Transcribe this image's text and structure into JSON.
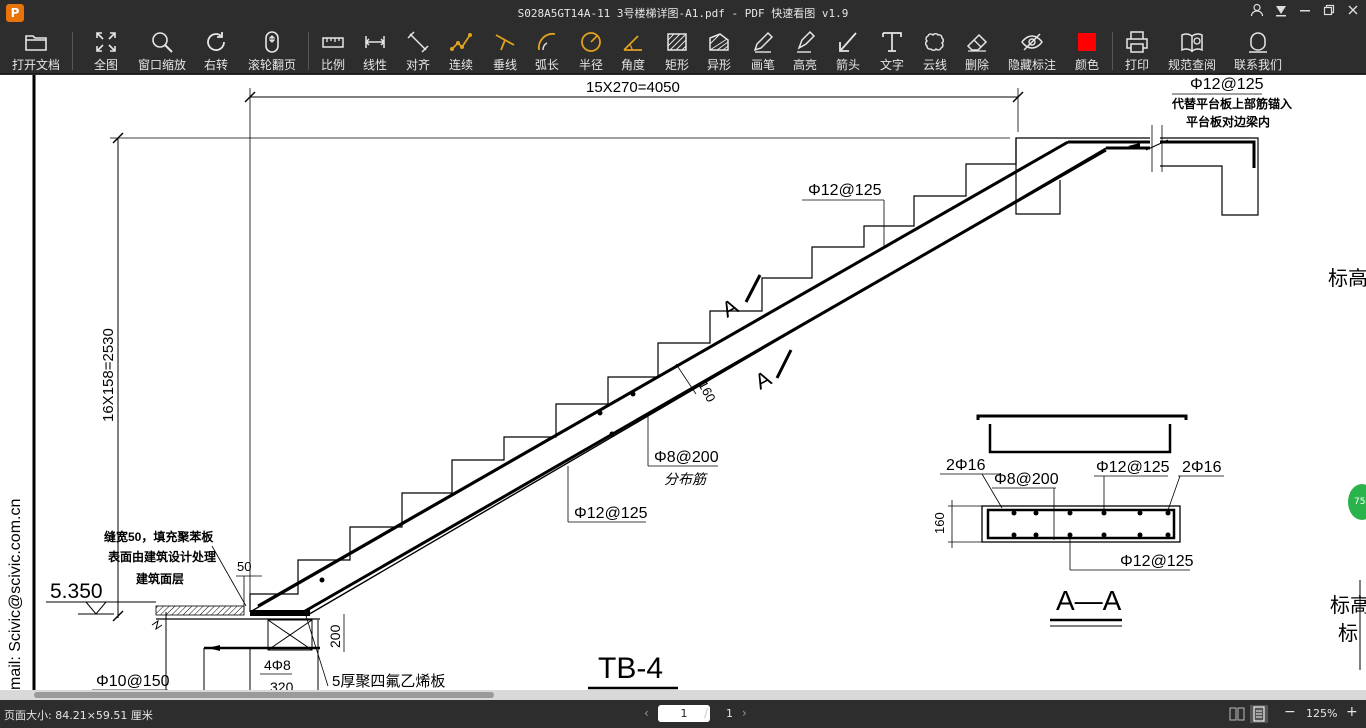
{
  "window": {
    "title": "S028A5GT14A-11 3号楼梯详图-A1.pdf - PDF 快速看图 v1.9",
    "logo": "P"
  },
  "toolbar": {
    "items": [
      {
        "id": "open",
        "label": "打开文档",
        "icon": "folder-icon"
      },
      {
        "id": "fit",
        "label": "全图",
        "icon": "expand-icon"
      },
      {
        "id": "window-zoom",
        "label": "窗口缩放",
        "icon": "zoom-icon"
      },
      {
        "id": "rotate",
        "label": "右转",
        "icon": "rotate-icon"
      },
      {
        "id": "wheel",
        "label": "滚轮翻页",
        "icon": "mouse-icon"
      },
      {
        "id": "scale",
        "label": "比例",
        "icon": "ruler-icon"
      },
      {
        "id": "linear",
        "label": "线性",
        "icon": "linear-dim-icon"
      },
      {
        "id": "align",
        "label": "对齐",
        "icon": "aligned-dim-icon"
      },
      {
        "id": "continuous",
        "label": "连续",
        "icon": "continuous-icon"
      },
      {
        "id": "perp",
        "label": "垂线",
        "icon": "perpendicular-icon"
      },
      {
        "id": "arc",
        "label": "弧长",
        "icon": "arc-icon"
      },
      {
        "id": "radius",
        "label": "半径",
        "icon": "radius-icon"
      },
      {
        "id": "angle",
        "label": "角度",
        "icon": "angle-icon"
      },
      {
        "id": "rect",
        "label": "矩形",
        "icon": "rect-area-icon"
      },
      {
        "id": "irregular",
        "label": "异形",
        "icon": "polygon-area-icon"
      },
      {
        "id": "pen",
        "label": "画笔",
        "icon": "pencil-icon"
      },
      {
        "id": "highlight",
        "label": "高亮",
        "icon": "highlighter-icon"
      },
      {
        "id": "arrow",
        "label": "箭头",
        "icon": "arrow-icon"
      },
      {
        "id": "text",
        "label": "文字",
        "icon": "text-icon"
      },
      {
        "id": "cloud",
        "label": "云线",
        "icon": "cloud-icon"
      },
      {
        "id": "delete",
        "label": "删除",
        "icon": "eraser-icon"
      },
      {
        "id": "hide",
        "label": "隐藏标注",
        "icon": "eye-off-icon"
      },
      {
        "id": "color",
        "label": "颜色",
        "icon": "color-swatch-icon"
      },
      {
        "id": "print",
        "label": "打印",
        "icon": "printer-icon"
      },
      {
        "id": "standards",
        "label": "规范查阅",
        "icon": "book-icon"
      },
      {
        "id": "contact",
        "label": "联系我们",
        "icon": "contact-icon"
      }
    ],
    "color_value": "#ff0000"
  },
  "drawing": {
    "dim_top": "15X270=4050",
    "dim_left": "16X158=2530",
    "rebar_top": "Φ12@125",
    "rebar_lower": "Φ12@125",
    "dist_rebar": "Φ8@200",
    "dist_label": "分布筋",
    "thickness": "160",
    "section_mark": "A",
    "platform_rebar": "Φ12@125",
    "platform_note1": "代替平台板上部筋锚入",
    "platform_note2": "平台板对边梁内",
    "joint_note1": "缝宽50，填充聚苯板",
    "joint_note2": "表面由建筑设计处理",
    "joint_note3": "建筑面层",
    "dim_50": "50",
    "elevation": "5.350",
    "beam_rebar": "Φ10@150",
    "beam_bars": "4Φ8",
    "beam_width": "320",
    "beam_height": "200",
    "ptfe": "5厚聚四氟乙烯板",
    "title": "TB-4",
    "sect": {
      "title": "A—A",
      "left_bars": "2Φ16",
      "right_bars": "2Φ16",
      "dist": "Φ8@200",
      "top": "Φ12@125",
      "bottom": "Φ12@125",
      "depth": "160"
    },
    "side_note1": "标高",
    "side_note2": "标高",
    "side_note3": "标",
    "margin_text": "mail: Scivic@scivic.com.cn"
  },
  "status": {
    "page_size": "页面大小: 84.21×59.51 厘米",
    "page_current": "1",
    "page_slash": "/",
    "page_total": "1",
    "zoom": "125%",
    "badge": "75"
  }
}
